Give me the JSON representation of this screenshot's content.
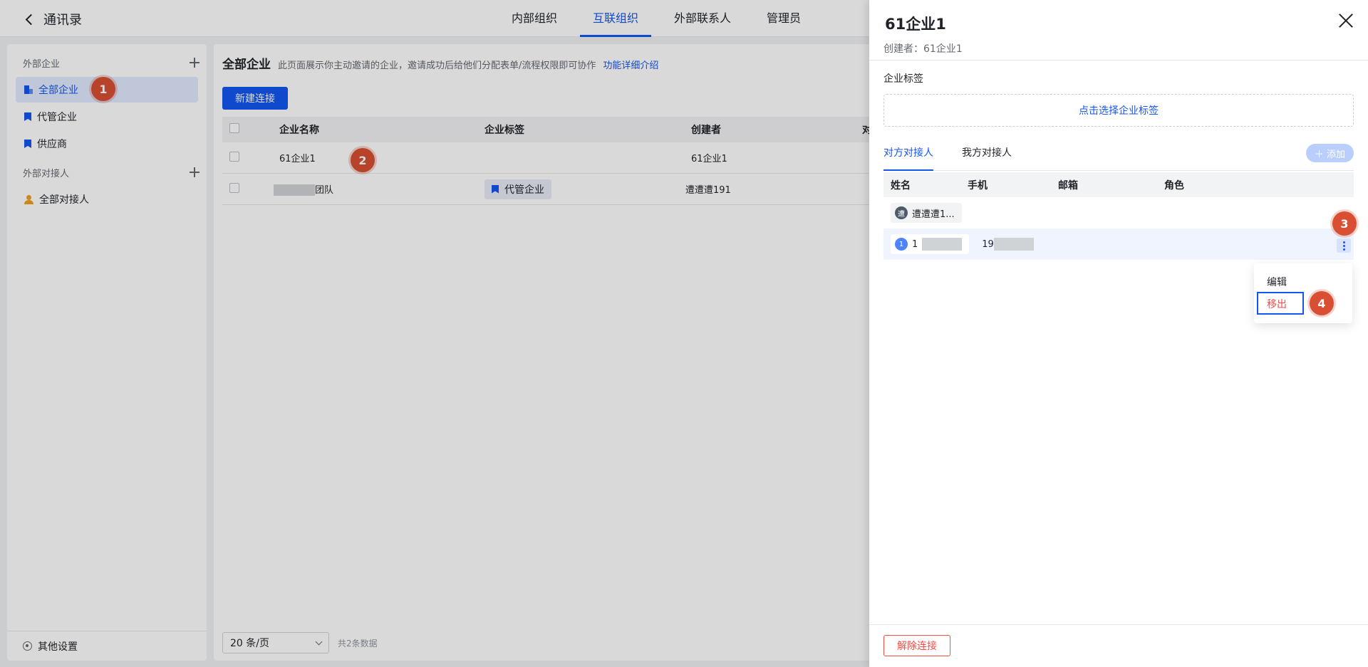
{
  "header": {
    "back_label": "通讯录",
    "tabs": [
      {
        "label": "内部组织",
        "active": false
      },
      {
        "label": "互联组织",
        "active": true
      },
      {
        "label": "外部联系人",
        "active": false
      },
      {
        "label": "管理员",
        "active": false
      }
    ]
  },
  "sidebar": {
    "section1": "外部企业",
    "items1": [
      {
        "label": "全部企业",
        "icon": "building-icon",
        "active": true
      },
      {
        "label": "代管企业",
        "icon": "bookmark-icon"
      },
      {
        "label": "供应商",
        "icon": "bookmark-icon"
      }
    ],
    "section2": "外部对接人",
    "items2": [
      {
        "label": "全部对接人",
        "icon": "user-icon"
      }
    ],
    "footer": "其他设置"
  },
  "main": {
    "title": "全部企业",
    "description": "此页面展示你主动邀请的企业，邀请成功后给他们分配表单/流程权限即可协作",
    "link": "功能详细介绍",
    "new_button": "新建连接",
    "columns": [
      "企业名称",
      "企业标签",
      "创建者",
      "对"
    ],
    "rows": [
      {
        "name": "61企业1",
        "tag": "",
        "creator": "61企业1"
      },
      {
        "name_suffix": "团队",
        "tag": "代管企业",
        "creator": "遭遭遭191"
      }
    ],
    "page_size": "20 条/页",
    "total": "共2条数据"
  },
  "drawer": {
    "title": "61企业1",
    "creator_line": "创建者：61企业1",
    "tag_label": "企业标签",
    "tag_placeholder": "点击选择企业标签",
    "tabs": [
      "对方对接人",
      "我方对接人"
    ],
    "add_button": "添加",
    "columns": [
      "姓名",
      "手机",
      "邮箱",
      "角色"
    ],
    "contacts": [
      {
        "name": "遭遭遭1...",
        "avatar": "遭",
        "phone": ""
      },
      {
        "name_prefix": "1",
        "avatar": "1",
        "phone_prefix": "19"
      }
    ],
    "menu": {
      "edit": "编辑",
      "remove": "移出"
    },
    "disconnect_button": "解除连接"
  },
  "markers": [
    "1",
    "2",
    "3",
    "4"
  ],
  "colors": {
    "accent": "#1456f0",
    "danger": "#f54a45",
    "marker": "#d94f33"
  }
}
